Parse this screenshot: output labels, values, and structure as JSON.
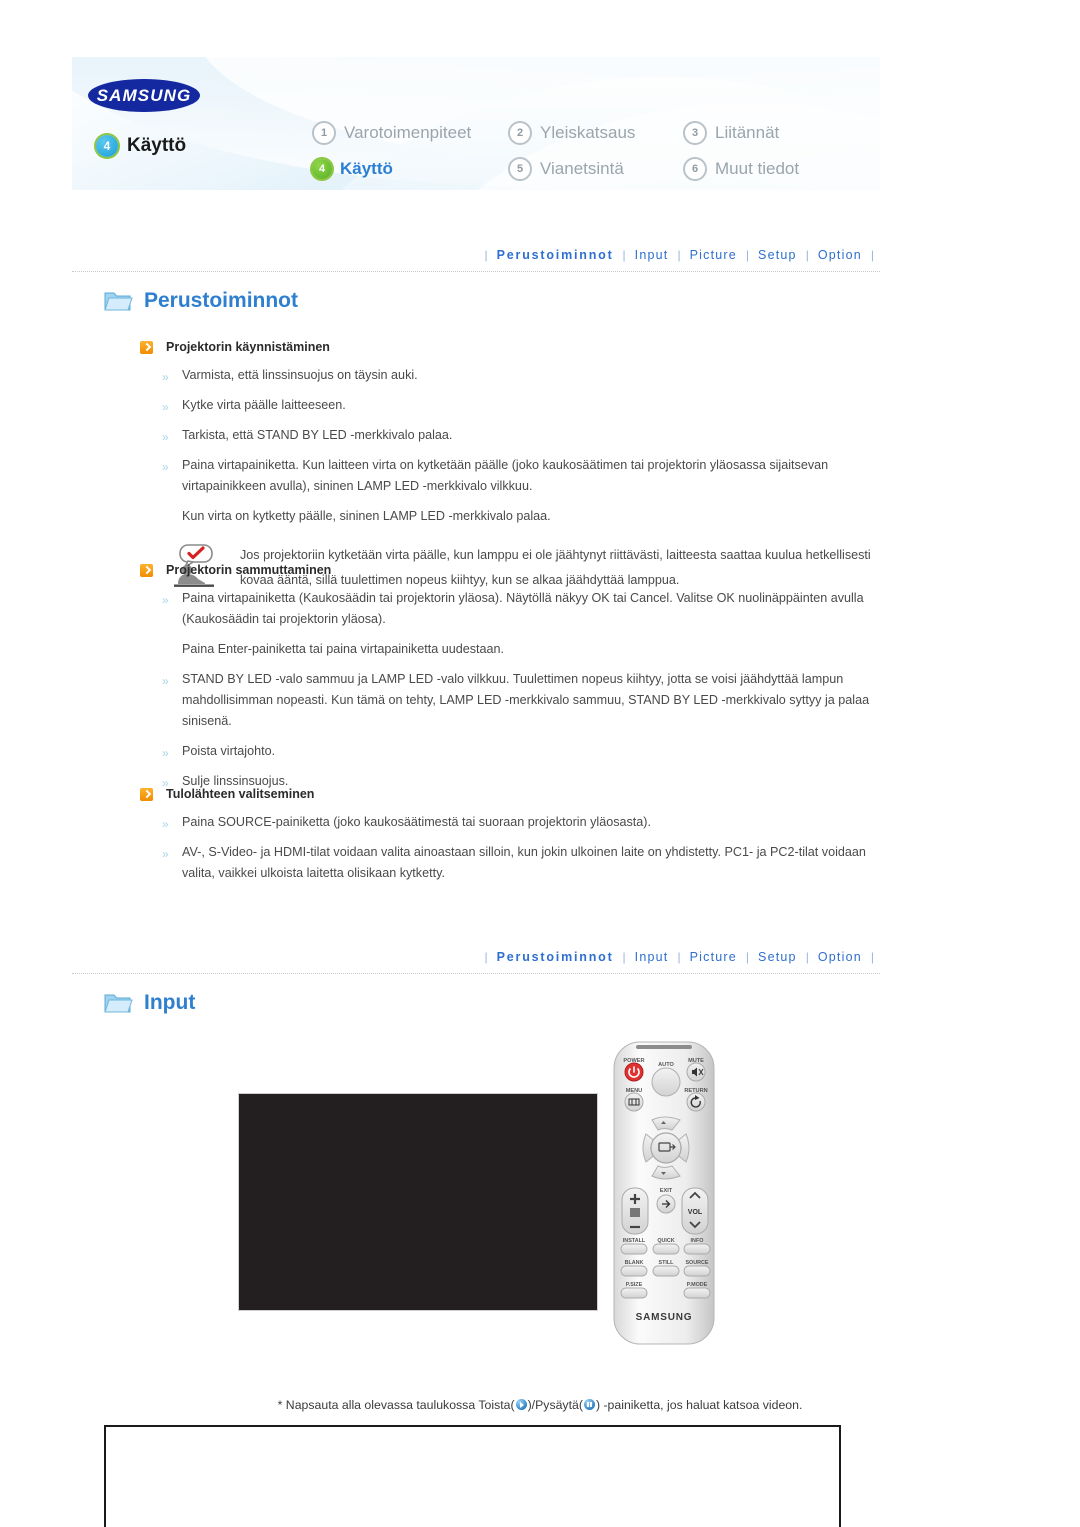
{
  "header": {
    "brand": "SAMSUNG",
    "current_chapter": {
      "number": "4",
      "label": "Käyttö"
    },
    "chapters": [
      {
        "number": "1",
        "label": "Varotoimenpiteet",
        "active": false
      },
      {
        "number": "2",
        "label": "Yleiskatsaus",
        "active": false
      },
      {
        "number": "3",
        "label": "Liitännät",
        "active": false
      },
      {
        "number": "4",
        "label": "Käyttö",
        "active": true
      },
      {
        "number": "5",
        "label": "Vianetsintä",
        "active": false
      },
      {
        "number": "6",
        "label": "Muut tiedot",
        "active": false
      }
    ]
  },
  "breadcrumb": {
    "items": [
      "Perustoiminnot",
      "Input",
      "Picture",
      "Setup",
      "Option"
    ],
    "separator": "|"
  },
  "sections": {
    "basic": {
      "title": "Perustoiminnot",
      "groups": [
        {
          "heading": "Projektorin käynnistäminen",
          "items": [
            "Varmista, että linssinsuojus on täysin auki.",
            "Kytke virta päälle laitteeseen.",
            "Tarkista, että STAND BY LED -merkkivalo palaa.",
            "Paina virtapainiketta. Kun laitteen virta on kytketään päälle (joko kaukosäätimen tai projektorin yläosassa sijaitsevan virtapainikkeen avulla), sininen LAMP LED -merkkivalo vilkkuu."
          ],
          "plain": [
            "Kun virta on kytketty päälle, sininen LAMP LED -merkkivalo palaa."
          ],
          "note": "Jos projektoriin kytketään virta päälle, kun lamppu ei ole jäähtynyt riittävästi, laitteesta saattaa kuulua hetkellisesti kovaa ääntä, sillä tuulettimen nopeus kiihtyy, kun se alkaa jäähdyttää lamppua."
        },
        {
          "heading": "Projektorin sammuttaminen",
          "items": [
            "Paina virtapainiketta (Kaukosäädin tai projektorin yläosa). Näytöllä näkyy OK tai Cancel. Valitse OK nuolinäppäinten avulla (Kaukosäädin tai projektorin yläosa).",
            "STAND BY LED -valo sammuu ja LAMP LED -valo vilkkuu. Tuulettimen nopeus kiihtyy, jotta se voisi jäähdyttää lampun mahdollisimman nopeasti. Kun tämä on tehty, LAMP LED -merkkivalo sammuu, STAND BY LED -merkkivalo syttyy ja palaa sinisenä.",
            "Poista virtajohto.",
            "Sulje linssinsuojus."
          ],
          "plain_mid": "Paina Enter-painiketta tai paina virtapainiketta uudestaan."
        },
        {
          "heading": "Tulolähteen valitseminen",
          "items": [
            "Paina SOURCE-painiketta (joko kaukosäätimestä tai suoraan projektorin yläosasta).",
            "AV-, S-Video- ja HDMI-tilat voidaan valita ainoastaan silloin, kun jokin ulkoinen laite on yhdistetty. PC1- ja PC2-tilat voidaan valita, vaikkei ulkoista laitetta olisikaan kytketty."
          ]
        }
      ]
    },
    "input": {
      "title": "Input"
    }
  },
  "remote": {
    "brand": "SAMSUNG",
    "buttons": {
      "power": "POWER",
      "auto": "AUTO",
      "mute": "MUTE",
      "menu": "MENU",
      "return": "RETURN",
      "exit": "EXIT",
      "vol": "VOL",
      "install": "INSTALL",
      "quick": "QUICK",
      "info": "INFO",
      "blank": "BLANK",
      "still": "STILL",
      "source": "SOURCE",
      "psize": "P.SIZE",
      "pmode": "P.MODE"
    }
  },
  "footnote": {
    "prefix": "* Napsauta alla olevassa taulukossa Toista(",
    "middle": ")/Pysäytä(",
    "suffix": ") -painiketta, jos haluat katsoa videon."
  }
}
